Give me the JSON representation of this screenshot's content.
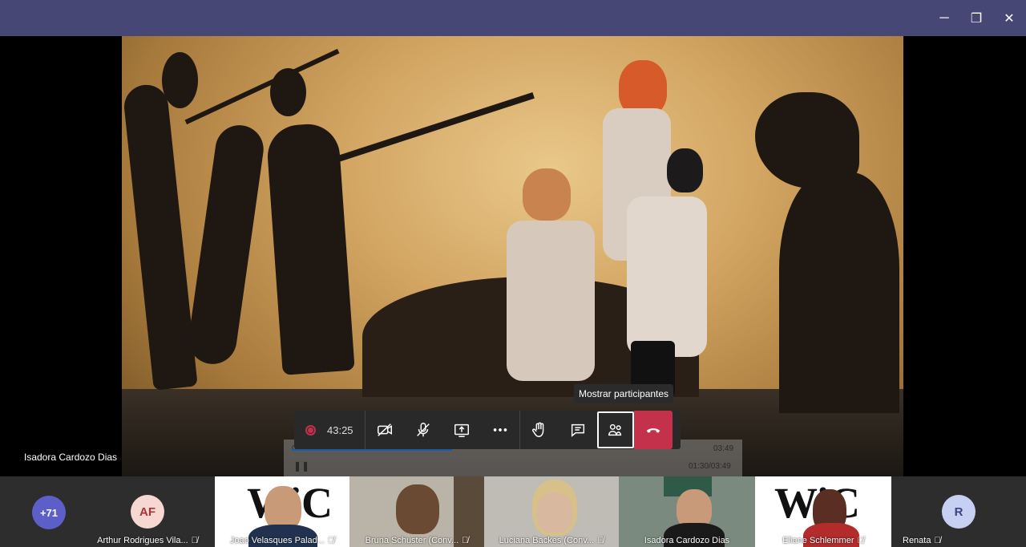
{
  "window": {
    "minimize_glyph": "─",
    "restore_glyph": "❐",
    "close_glyph": "✕"
  },
  "presenter": {
    "name": "Isadora Cardozo Dias"
  },
  "scrubber": {
    "time_left": "01:30",
    "time_right": "03:49",
    "time_combined": "01:30/03:49"
  },
  "tooltip": {
    "text": "Mostrar participantes"
  },
  "toolbar": {
    "timer": "43:25"
  },
  "participants": {
    "overflow_count": "+71",
    "tiles": [
      {
        "name": "Arthur Rodrigues Vila...",
        "initials": "AF",
        "avatar_bg": "#f6d7d1",
        "avatar_fg": "#a4373a"
      },
      {
        "name": "Joao Velasques Palad...",
        "logo": "WiC"
      },
      {
        "name": "Bruna Schuster (Conv..."
      },
      {
        "name": "Luciana Backes (Conv..."
      },
      {
        "name": "Isadora Cardozo Dias"
      },
      {
        "name": "Eliane Schlemmer",
        "logo": "WiC"
      },
      {
        "name": "Renata",
        "initials": "R",
        "avatar_bg": "#c7d0f2",
        "avatar_fg": "#3a4480"
      }
    ]
  },
  "colors": {
    "titlebar": "#464775",
    "hangup": "#c4314b",
    "toolbar": "#292929",
    "strip": "#2d2d2d",
    "overflow_avatar": "#5b5fc7"
  }
}
